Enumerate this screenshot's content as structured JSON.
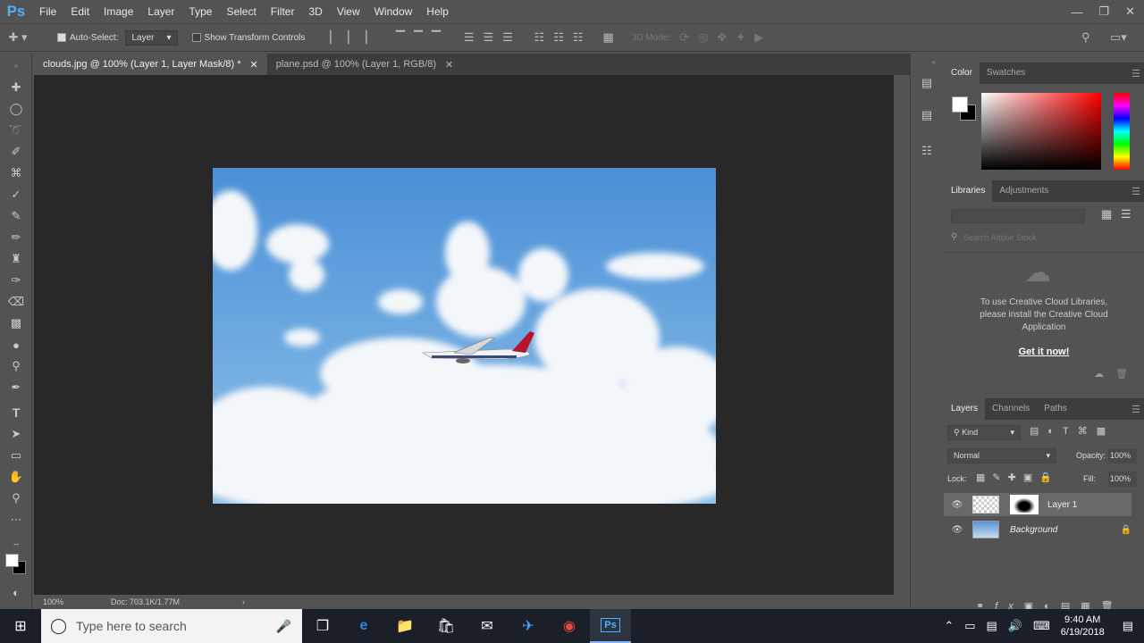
{
  "app": {
    "logo": "Ps"
  },
  "menu": [
    "File",
    "Edit",
    "Image",
    "Layer",
    "Type",
    "Select",
    "Filter",
    "3D",
    "View",
    "Window",
    "Help"
  ],
  "options": {
    "auto_select_label": "Auto-Select:",
    "auto_select_value": "Layer",
    "transform_controls_label": "Show Transform Controls",
    "mode_3d_label": "3D Mode:"
  },
  "tabs": [
    {
      "label": "clouds.jpg @ 100% (Layer 1, Layer Mask/8) *",
      "active": true
    },
    {
      "label": "plane.psd @ 100% (Layer 1, RGB/8)",
      "active": false
    }
  ],
  "status": {
    "zoom": "100%",
    "doc": "Doc: 703.1K/1.77M"
  },
  "color_panel": {
    "tabs": [
      "Color",
      "Swatches"
    ],
    "foreground": "#ffffff",
    "background": "#000000"
  },
  "libraries_panel": {
    "tabs": [
      "Libraries",
      "Adjustments"
    ],
    "search_placeholder": "Search Adobe Stock",
    "message": "To use Creative Cloud Libraries, please install the Creative Cloud Application",
    "link": "Get it now!"
  },
  "layers_panel": {
    "tabs": [
      "Layers",
      "Channels",
      "Paths"
    ],
    "filter_kind": "Kind",
    "blend_mode": "Normal",
    "opacity_label": "Opacity:",
    "opacity_value": "100%",
    "lock_label": "Lock:",
    "fill_label": "Fill:",
    "fill_value": "100%",
    "layers": [
      {
        "name": "Layer 1",
        "selected": true
      },
      {
        "name": "Background",
        "locked": true
      }
    ]
  },
  "taskbar": {
    "search_placeholder": "Type here to search",
    "time": "9:40 AM",
    "date": "6/19/2018"
  }
}
